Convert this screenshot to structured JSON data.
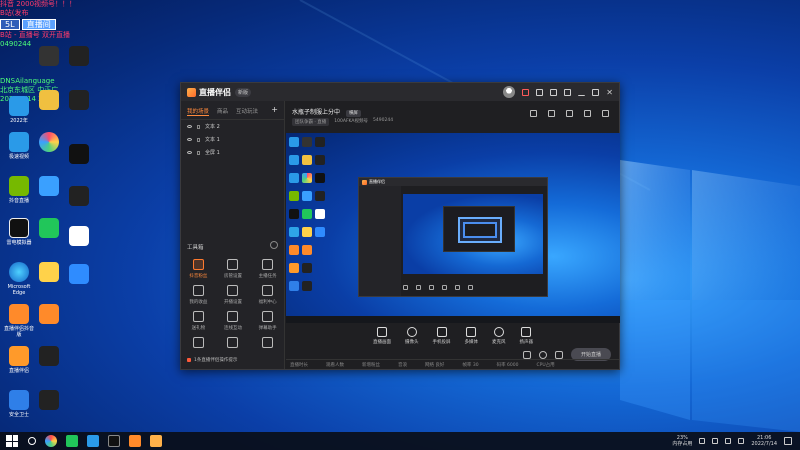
{
  "desktop": {
    "overlay": {
      "line1": "抖音 2000视频号！！！",
      "line2": "B站(发布",
      "badge1": "5L",
      "badge2": "直播间",
      "line3": "B站 - 直播号 双开直播",
      "line4": "0490244",
      "line5": "DNSAilanguage",
      "line6": "北京东城区 中正广",
      "line7": "2022/7/14 21:06"
    },
    "icons": [
      {
        "label": "2022年",
        "color": "#ffffff"
      },
      {
        "label": "极速视频",
        "color": "#f0c040"
      },
      {
        "label": "抖音直播",
        "color": "#ff4a6a"
      },
      {
        "label": "雷电模拟器",
        "color": "#ffd24a"
      },
      {
        "label": "直播",
        "color": "#00c853"
      },
      {
        "label": "浏览器",
        "color": "#3aa0ff"
      },
      {
        "label": "直播伴侣",
        "color": "#fff"
      },
      {
        "label": "Microsoft Edge",
        "color": "#2ea4e8"
      },
      {
        "label": "直播伴侣抖音版",
        "color": "#ff9a2a"
      },
      {
        "label": "哔哩哔哩",
        "color": "#fff"
      },
      {
        "label": "直播伴侣",
        "color": "#ff8a2a"
      },
      {
        "label": "LiveVideo",
        "color": "#fff"
      },
      {
        "label": "安全卫士",
        "color": "#3aa0ff"
      }
    ]
  },
  "app": {
    "title": "直播伴侣",
    "version": "新版",
    "tabs": [
      "我的场景",
      "商品",
      "互动玩法"
    ],
    "sources": [
      "文本 2",
      "文本 1",
      "全屏 1"
    ],
    "toolbox_title": "工具箱",
    "tools": [
      {
        "label": "抖音粉丝",
        "hot": true
      },
      {
        "label": "房管设置",
        "hot": false
      },
      {
        "label": "主播任务",
        "hot": false
      },
      {
        "label": "我的收益",
        "hot": false
      },
      {
        "label": "开播设置",
        "hot": false
      },
      {
        "label": "福利中心",
        "hot": false
      },
      {
        "label": "送礼物",
        "hot": false
      },
      {
        "label": "连线互动",
        "hot": false
      },
      {
        "label": "弹幕助手",
        "hot": false
      },
      {
        "label": "",
        "hot": false
      },
      {
        "label": "",
        "hot": false
      },
      {
        "label": "",
        "hot": false
      }
    ],
    "footer_text": "1条直播伴侣操作提示",
    "room_title": "水瓶子制服上分中",
    "room_tag": "横屏",
    "room_meta": [
      "团队争霸 · 直播",
      "100AFKA视频号",
      "5490244"
    ],
    "controls": [
      {
        "label": "直播画面"
      },
      {
        "label": "摄像头"
      },
      {
        "label": "手机投屏"
      },
      {
        "label": "多媒体"
      },
      {
        "label": "麦克风"
      },
      {
        "label": "扬声器"
      }
    ],
    "go_live": "开始直播",
    "status": [
      "直播时长",
      "观看人数",
      "新增粉丝",
      "音浪",
      "网络 良好",
      "帧率 30",
      "码率 6000",
      "CPU占用"
    ]
  },
  "taskbar": {
    "tray_line1": "23%",
    "tray_line2": "内存占用",
    "time": "21:06",
    "date": "2022/7/14"
  }
}
